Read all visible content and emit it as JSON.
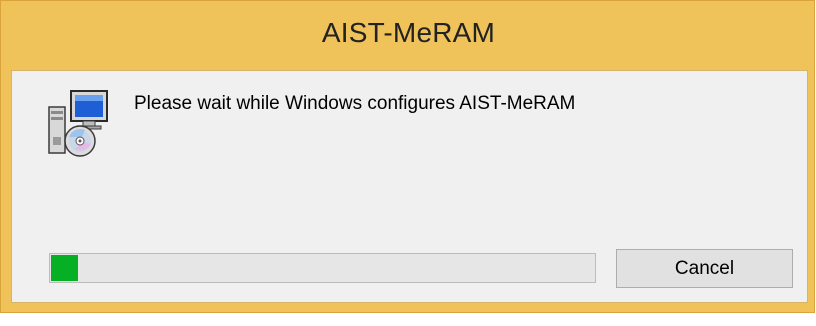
{
  "window": {
    "title": "AIST-MeRAM"
  },
  "dialog": {
    "message": "Please wait while Windows configures AIST-MeRAM",
    "icon": "installer-icon"
  },
  "progress": {
    "fraction": 0.05
  },
  "buttons": {
    "cancel_label": "Cancel"
  },
  "colors": {
    "frame": "#f0c35a",
    "client": "#f0f0f0",
    "progress_fill": "#06b025"
  }
}
